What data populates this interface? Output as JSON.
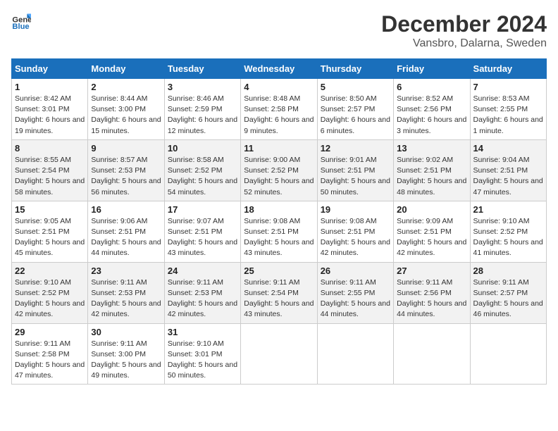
{
  "header": {
    "logo_general": "General",
    "logo_blue": "Blue",
    "title": "December 2024",
    "subtitle": "Vansbro, Dalarna, Sweden"
  },
  "weekdays": [
    "Sunday",
    "Monday",
    "Tuesday",
    "Wednesday",
    "Thursday",
    "Friday",
    "Saturday"
  ],
  "weeks": [
    [
      {
        "day": "1",
        "sunrise": "8:42 AM",
        "sunset": "3:01 PM",
        "daylight": "6 hours and 19 minutes."
      },
      {
        "day": "2",
        "sunrise": "8:44 AM",
        "sunset": "3:00 PM",
        "daylight": "6 hours and 15 minutes."
      },
      {
        "day": "3",
        "sunrise": "8:46 AM",
        "sunset": "2:59 PM",
        "daylight": "6 hours and 12 minutes."
      },
      {
        "day": "4",
        "sunrise": "8:48 AM",
        "sunset": "2:58 PM",
        "daylight": "6 hours and 9 minutes."
      },
      {
        "day": "5",
        "sunrise": "8:50 AM",
        "sunset": "2:57 PM",
        "daylight": "6 hours and 6 minutes."
      },
      {
        "day": "6",
        "sunrise": "8:52 AM",
        "sunset": "2:56 PM",
        "daylight": "6 hours and 3 minutes."
      },
      {
        "day": "7",
        "sunrise": "8:53 AM",
        "sunset": "2:55 PM",
        "daylight": "6 hours and 1 minute."
      }
    ],
    [
      {
        "day": "8",
        "sunrise": "8:55 AM",
        "sunset": "2:54 PM",
        "daylight": "5 hours and 58 minutes."
      },
      {
        "day": "9",
        "sunrise": "8:57 AM",
        "sunset": "2:53 PM",
        "daylight": "5 hours and 56 minutes."
      },
      {
        "day": "10",
        "sunrise": "8:58 AM",
        "sunset": "2:52 PM",
        "daylight": "5 hours and 54 minutes."
      },
      {
        "day": "11",
        "sunrise": "9:00 AM",
        "sunset": "2:52 PM",
        "daylight": "5 hours and 52 minutes."
      },
      {
        "day": "12",
        "sunrise": "9:01 AM",
        "sunset": "2:51 PM",
        "daylight": "5 hours and 50 minutes."
      },
      {
        "day": "13",
        "sunrise": "9:02 AM",
        "sunset": "2:51 PM",
        "daylight": "5 hours and 48 minutes."
      },
      {
        "day": "14",
        "sunrise": "9:04 AM",
        "sunset": "2:51 PM",
        "daylight": "5 hours and 47 minutes."
      }
    ],
    [
      {
        "day": "15",
        "sunrise": "9:05 AM",
        "sunset": "2:51 PM",
        "daylight": "5 hours and 45 minutes."
      },
      {
        "day": "16",
        "sunrise": "9:06 AM",
        "sunset": "2:51 PM",
        "daylight": "5 hours and 44 minutes."
      },
      {
        "day": "17",
        "sunrise": "9:07 AM",
        "sunset": "2:51 PM",
        "daylight": "5 hours and 43 minutes."
      },
      {
        "day": "18",
        "sunrise": "9:08 AM",
        "sunset": "2:51 PM",
        "daylight": "5 hours and 43 minutes."
      },
      {
        "day": "19",
        "sunrise": "9:08 AM",
        "sunset": "2:51 PM",
        "daylight": "5 hours and 42 minutes."
      },
      {
        "day": "20",
        "sunrise": "9:09 AM",
        "sunset": "2:51 PM",
        "daylight": "5 hours and 42 minutes."
      },
      {
        "day": "21",
        "sunrise": "9:10 AM",
        "sunset": "2:52 PM",
        "daylight": "5 hours and 41 minutes."
      }
    ],
    [
      {
        "day": "22",
        "sunrise": "9:10 AM",
        "sunset": "2:52 PM",
        "daylight": "5 hours and 42 minutes."
      },
      {
        "day": "23",
        "sunrise": "9:11 AM",
        "sunset": "2:53 PM",
        "daylight": "5 hours and 42 minutes."
      },
      {
        "day": "24",
        "sunrise": "9:11 AM",
        "sunset": "2:53 PM",
        "daylight": "5 hours and 42 minutes."
      },
      {
        "day": "25",
        "sunrise": "9:11 AM",
        "sunset": "2:54 PM",
        "daylight": "5 hours and 43 minutes."
      },
      {
        "day": "26",
        "sunrise": "9:11 AM",
        "sunset": "2:55 PM",
        "daylight": "5 hours and 44 minutes."
      },
      {
        "day": "27",
        "sunrise": "9:11 AM",
        "sunset": "2:56 PM",
        "daylight": "5 hours and 44 minutes."
      },
      {
        "day": "28",
        "sunrise": "9:11 AM",
        "sunset": "2:57 PM",
        "daylight": "5 hours and 46 minutes."
      }
    ],
    [
      {
        "day": "29",
        "sunrise": "9:11 AM",
        "sunset": "2:58 PM",
        "daylight": "5 hours and 47 minutes."
      },
      {
        "day": "30",
        "sunrise": "9:11 AM",
        "sunset": "3:00 PM",
        "daylight": "5 hours and 49 minutes."
      },
      {
        "day": "31",
        "sunrise": "9:10 AM",
        "sunset": "3:01 PM",
        "daylight": "5 hours and 50 minutes."
      },
      null,
      null,
      null,
      null
    ]
  ],
  "labels": {
    "sunrise": "Sunrise:",
    "sunset": "Sunset:",
    "daylight": "Daylight:"
  }
}
